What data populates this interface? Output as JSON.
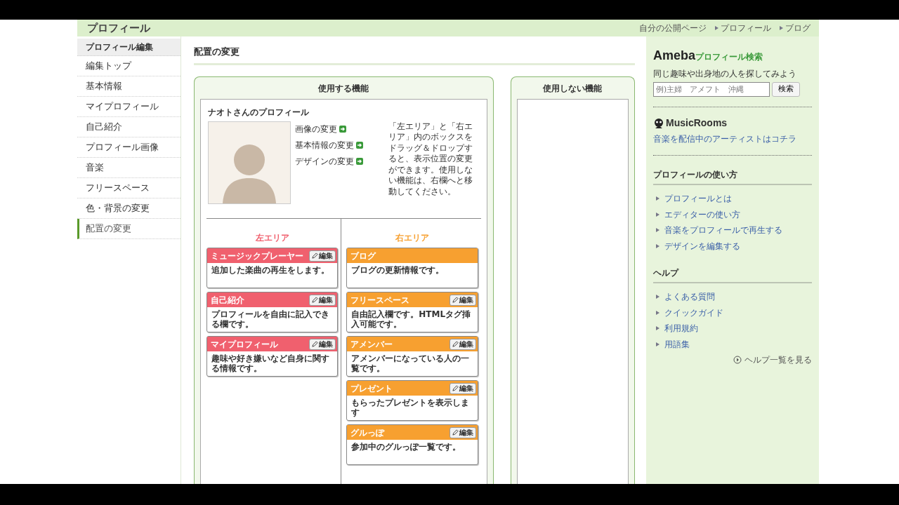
{
  "header": {
    "title": "プロフィール",
    "links": [
      "自分の公開ページ",
      "プロフィール",
      "ブログ"
    ]
  },
  "sidebar": {
    "items": [
      {
        "label": "プロフィール編集",
        "kind": "heading",
        "selected": false
      },
      {
        "label": "編集トップ",
        "kind": "link",
        "selected": false
      },
      {
        "label": "基本情報",
        "kind": "link",
        "selected": false
      },
      {
        "label": "マイプロフィール",
        "kind": "link",
        "selected": false
      },
      {
        "label": "自己紹介",
        "kind": "link",
        "selected": false
      },
      {
        "label": "プロフィール画像",
        "kind": "link",
        "selected": false
      },
      {
        "label": "音楽",
        "kind": "link",
        "selected": false
      },
      {
        "label": "フリースペース",
        "kind": "link",
        "selected": false
      },
      {
        "label": "色・背景の変更",
        "kind": "link",
        "selected": false
      },
      {
        "label": "配置の変更",
        "kind": "link",
        "selected": true
      }
    ]
  },
  "main": {
    "title": "配置の変更",
    "used_panel": {
      "title": "使用する機能",
      "profile": {
        "name": "ナオトさんのプロフィール",
        "links": [
          "画像の変更",
          "基本情報の変更",
          "デザインの変更"
        ],
        "help": {
          "before": "「左エリア」と「右エリア」内のボックスを",
          "link": "ドラッグ＆ドロップ",
          "after": "すると、表示位置の変更ができます。使用しない機能は、右欄へと移動してください。"
        }
      },
      "areas": [
        {
          "title": "左エリア",
          "color": "#f0606e",
          "modules": [
            {
              "title": "ミュージックプレーヤー",
              "edit": "編集",
              "description": "追加した楽曲の再生をします。"
            },
            {
              "title": "自己紹介",
              "edit": "編集",
              "description": "プロフィールを自由に記入できる欄です。"
            },
            {
              "title": "マイプロフィール",
              "edit": "編集",
              "description": "趣味や好き嫌いなど自身に関する情報です。"
            }
          ]
        },
        {
          "title": "右エリア",
          "color": "#f7a030",
          "modules": [
            {
              "title": "ブログ",
              "description": "ブログの更新情報です。"
            },
            {
              "title": "フリースペース",
              "edit": "編集",
              "description": "自由記入欄です。HTMLタグ挿入可能です。"
            },
            {
              "title": "アメンバー",
              "edit": "編集",
              "description": "アメンバーになっている人の一覧です。"
            },
            {
              "title": "プレゼント",
              "edit": "編集",
              "description": "もらったプレゼントを表示します"
            },
            {
              "title": "グルっぽ",
              "edit": "編集",
              "description": "参加中のグルっぽ一覧です。"
            }
          ]
        }
      ]
    },
    "unused_panel": {
      "title": "使用しない機能"
    }
  },
  "right_sidebar": {
    "search": {
      "logo": "Ameba",
      "logo_sub": "プロフィール検索",
      "caption": "同じ趣味や出身地の人を探してみよう",
      "placeholder": "例)主婦　アメフト　沖縄",
      "button": "検索"
    },
    "music": {
      "logo": "MusicRooms",
      "link": "音楽を配信中のアーティストはコチラ"
    },
    "sections": [
      {
        "title": "プロフィールの使い方",
        "links": [
          "プロフィールとは",
          "エディターの使い方",
          "音楽をプロフィールで再生する",
          "デザインを編集する"
        ]
      },
      {
        "title": "ヘルプ",
        "links": [
          "よくある質問",
          "クイックガイド",
          "利用規約",
          "用語集"
        ]
      }
    ],
    "more": "ヘルプ一覧を見る"
  }
}
